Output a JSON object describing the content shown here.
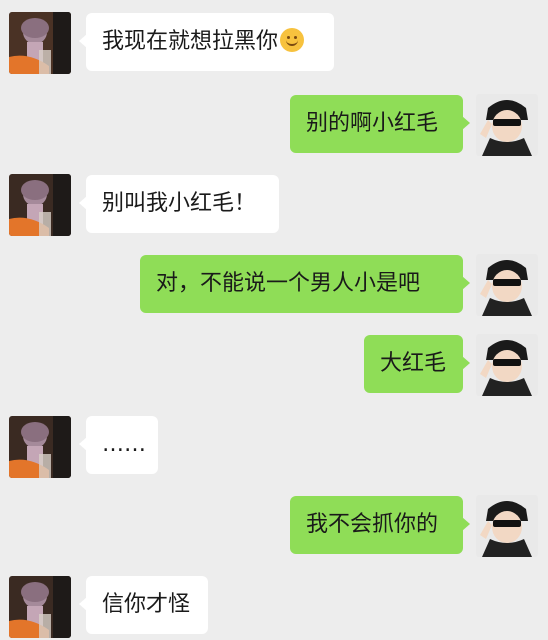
{
  "messages": [
    {
      "side": "in",
      "text": "我现在就想拉黑你",
      "emoji": "smile-emoji"
    },
    {
      "side": "out",
      "text": "别的啊小红毛"
    },
    {
      "side": "in",
      "text": "别叫我小红毛！"
    },
    {
      "side": "out",
      "text": "对，不能说一个男人小是吧"
    },
    {
      "side": "out",
      "text": "大红毛"
    },
    {
      "side": "in",
      "text": "……"
    },
    {
      "side": "out",
      "text": "我不会抓你的"
    },
    {
      "side": "in",
      "text": "信你才怪"
    }
  ],
  "colors": {
    "background": "#ededed",
    "incoming_bubble": "#ffffff",
    "outgoing_bubble": "#8fdd57"
  }
}
